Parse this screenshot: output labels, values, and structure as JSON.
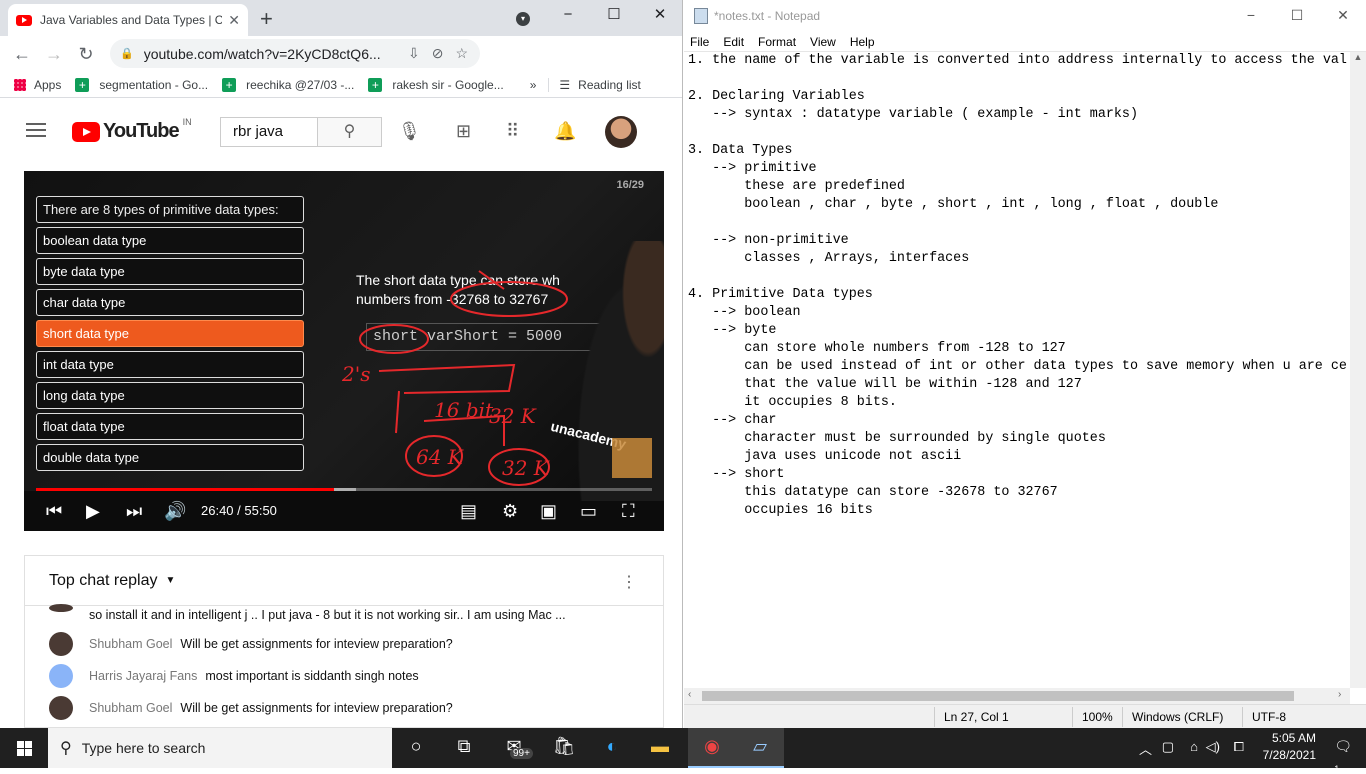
{
  "chrome": {
    "tab_title": "Java Variables and Data Types | Core Java",
    "tab_close": "✕",
    "new_tab": "+",
    "window_controls": [
      "−",
      "☐",
      "✕"
    ],
    "url": "youtube.com/watch?v=2KyCD8ctQ6...",
    "bookmarks": [
      {
        "label": "Apps",
        "icon": "apps-grid-icon"
      },
      {
        "label": "segmentation - Go...",
        "icon": "sheets-icon"
      },
      {
        "label": "reechika @27/03 -...",
        "icon": "sheets-icon"
      },
      {
        "label": "rakesh sir - Google...",
        "icon": "sheets-icon"
      }
    ],
    "bookmarks_overflow": "»",
    "reading_list": "Reading list"
  },
  "youtube": {
    "logo_text": "YouTube",
    "region": "IN",
    "search_query": "rbr java",
    "video": {
      "slide_number": "16/29",
      "list_header": "There are 8 types of primitive data types:",
      "items": [
        {
          "label": "boolean data type",
          "selected": false
        },
        {
          "label": "byte data type",
          "selected": false
        },
        {
          "label": "char data type",
          "selected": false
        },
        {
          "label": "short data type",
          "selected": true
        },
        {
          "label": "int data type",
          "selected": false
        },
        {
          "label": "long data type",
          "selected": false
        },
        {
          "label": "float data type",
          "selected": false
        },
        {
          "label": "double data type",
          "selected": false
        }
      ],
      "short_desc_line1": "The short data type can store wh",
      "short_desc_line2": "numbers from -32768 to 32767",
      "code": "short varShort = 5000",
      "watermark": "unacademy",
      "ink_labels": [
        "2's",
        "16 bit",
        "32 K",
        "64 K",
        "32 K"
      ],
      "progress_fraction": 0.4836,
      "buffered_fraction": 0.52,
      "time_current": "26:40",
      "time_total": "55:50",
      "time_display": "26:40 / 55:50"
    },
    "chat": {
      "title": "Top chat replay",
      "messages": [
        {
          "name": "",
          "text": "so install it and in intelligent j .. I put java - 8 but it is not working sir.. I am using Mac ..."
        },
        {
          "name": "Shubham Goel",
          "text": "Will be get assignments for inteview preparation?"
        },
        {
          "name": "Harris Jayaraj Fans",
          "text": "most important is siddanth singh notes"
        },
        {
          "name": "Shubham Goel",
          "text": "Will be get assignments for inteview preparation?"
        }
      ]
    }
  },
  "notepad": {
    "title": "*notes.txt - Notepad",
    "menu": [
      "File",
      "Edit",
      "Format",
      "View",
      "Help"
    ],
    "lines": [
      "1. the name of the variable is converted into address internally to access the val",
      "",
      "2. Declaring Variables",
      "   --> syntax : datatype variable ( example - int marks)",
      "",
      "3. Data Types",
      "   --> primitive",
      "       these are predefined",
      "       boolean , char , byte , short , int , long , float , double",
      "",
      "   --> non-primitive",
      "       classes , Arrays, interfaces",
      "",
      "4. Primitive Data types",
      "   --> boolean",
      "   --> byte",
      "       can store whole numbers from -128 to 127",
      "       can be used instead of int or other data types to save memory when u are ce",
      "       that the value will be within -128 and 127",
      "       it occupies 8 bits.",
      "   --> char",
      "       character must be surrounded by single quotes",
      "       java uses unicode not ascii",
      "   --> short",
      "       this datatype can store -32678 to 32767",
      "       occupies 16 bits"
    ],
    "status": {
      "position": "Ln 27, Col 1",
      "zoom": "100%",
      "line_endings": "Windows (CRLF)",
      "encoding": "UTF-8"
    }
  },
  "taskbar": {
    "search_placeholder": "Type here to search",
    "mail_badge": "99+",
    "time": "5:05 AM",
    "date": "7/28/2021",
    "notification_count": "1"
  }
}
